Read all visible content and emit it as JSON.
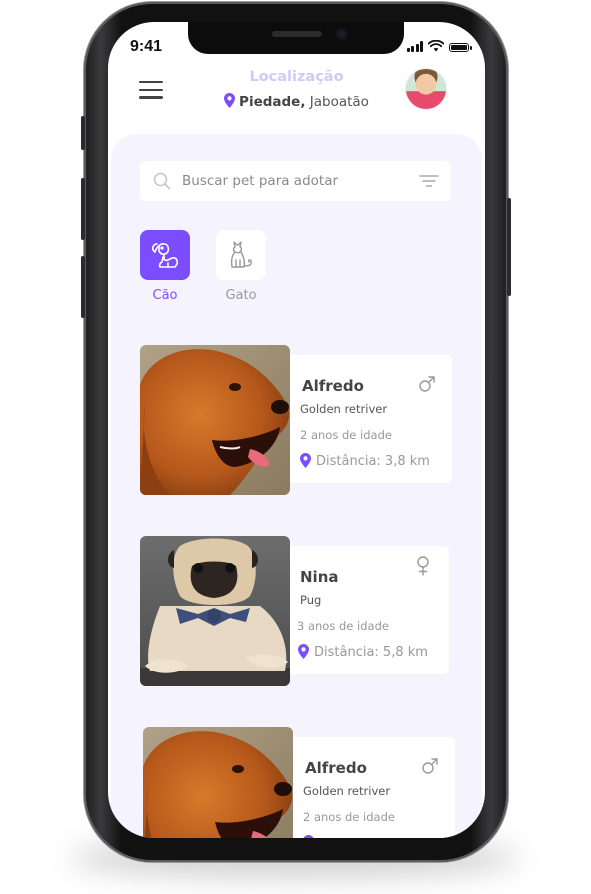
{
  "status_bar": {
    "time": "9:41"
  },
  "header": {
    "location_title": "Localização",
    "location_city": "Piedade,",
    "location_region": "Jaboatão",
    "menu_icon": "hamburger-menu-icon",
    "avatar_icon": "user-avatar"
  },
  "search": {
    "placeholder": "Buscar pet para adotar",
    "value": ""
  },
  "colors": {
    "accent": "#7c4dff",
    "background": "#f5f3fd",
    "title_light": "#d2c9f5"
  },
  "categories": [
    {
      "label": "Cão",
      "icon": "dog-icon",
      "selected": true
    },
    {
      "label": "Gato",
      "icon": "cat-icon",
      "selected": false
    }
  ],
  "pets": [
    {
      "name": "Alfredo",
      "breed": "Golden retriver",
      "age": "2 anos de idade",
      "distance": "Distância: 3,8 km",
      "gender": "male",
      "photo": "golden-retriever-photo"
    },
    {
      "name": "Nina",
      "breed": "Pug",
      "age": "3 anos de idade",
      "distance": "Distância: 5,8 km",
      "gender": "female",
      "photo": "pug-photo"
    },
    {
      "name": "Alfredo",
      "breed": "Golden retriver",
      "age": "2 anos de idade",
      "distance": "",
      "gender": "male",
      "photo": "golden-retriever-photo"
    }
  ]
}
